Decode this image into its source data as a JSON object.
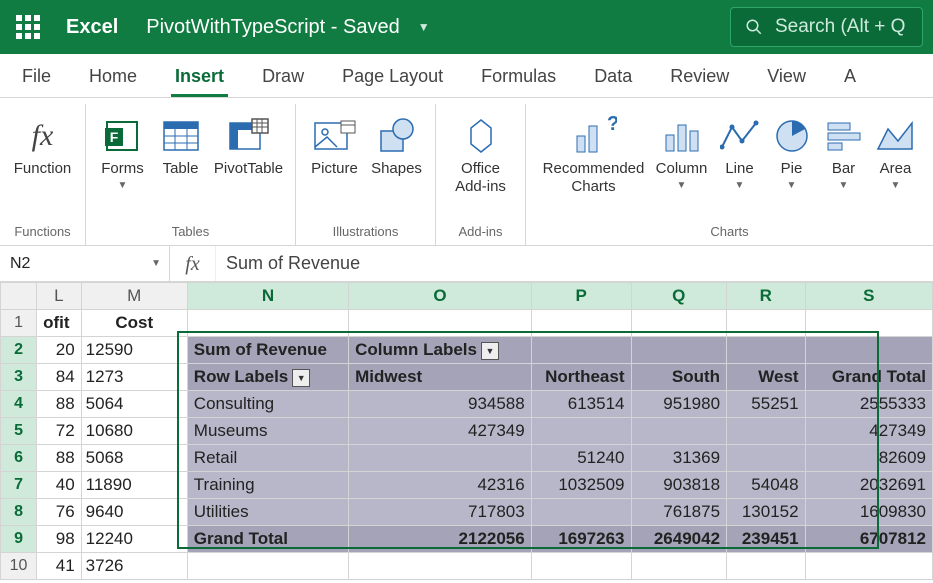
{
  "header": {
    "app": "Excel",
    "doc": "PivotWithTypeScript - Saved",
    "search_placeholder": "Search (Alt + Q"
  },
  "tabs": [
    "File",
    "Home",
    "Insert",
    "Draw",
    "Page Layout",
    "Formulas",
    "Data",
    "Review",
    "View",
    "A"
  ],
  "active_tab": "Insert",
  "ribbon": {
    "groups": [
      {
        "label": "Functions",
        "tools": [
          {
            "name": "Function"
          }
        ]
      },
      {
        "label": "Tables",
        "tools": [
          {
            "name": "Forms",
            "dd": true
          },
          {
            "name": "Table"
          },
          {
            "name": "PivotTable"
          }
        ]
      },
      {
        "label": "Illustrations",
        "tools": [
          {
            "name": "Picture"
          },
          {
            "name": "Shapes"
          }
        ]
      },
      {
        "label": "Add-ins",
        "tools": [
          {
            "name": "Office Add-ins"
          }
        ]
      },
      {
        "label": "Charts",
        "tools": [
          {
            "name": "Recommended Charts"
          },
          {
            "name": "Column",
            "dd": true
          },
          {
            "name": "Line",
            "dd": true
          },
          {
            "name": "Pie",
            "dd": true
          },
          {
            "name": "Bar",
            "dd": true
          },
          {
            "name": "Area",
            "dd": true
          }
        ]
      }
    ]
  },
  "namebox": "N2",
  "formula": "Sum of Revenue",
  "columns": [
    "",
    "L",
    "M",
    "N",
    "O",
    "P",
    "Q",
    "R",
    "S"
  ],
  "selected_cols": [
    "N",
    "O",
    "P",
    "Q",
    "R",
    "S"
  ],
  "left_data": {
    "header": {
      "L": "ofit",
      "M": "Cost"
    },
    "rows": [
      {
        "L": "20",
        "M": "12590"
      },
      {
        "L": "84",
        "M": "1273"
      },
      {
        "L": "88",
        "M": "5064"
      },
      {
        "L": "72",
        "M": "10680"
      },
      {
        "L": "88",
        "M": "5068"
      },
      {
        "L": "40",
        "M": "11890"
      },
      {
        "L": "76",
        "M": "9640"
      },
      {
        "L": "98",
        "M": "12240"
      },
      {
        "L": "41",
        "M": "3726"
      }
    ]
  },
  "pivot": {
    "title": "Sum of Revenue",
    "col_labels_title": "Column Labels",
    "row_labels_title": "Row Labels",
    "col_headers": [
      "Midwest",
      "Northeast",
      "South",
      "West",
      "Grand Total"
    ],
    "rows": [
      {
        "label": "Consulting",
        "vals": [
          "934588",
          "613514",
          "951980",
          "55251",
          "2555333"
        ]
      },
      {
        "label": "Museums",
        "vals": [
          "427349",
          "",
          "",
          "",
          "427349"
        ]
      },
      {
        "label": "Retail",
        "vals": [
          "",
          "51240",
          "31369",
          "",
          "82609"
        ]
      },
      {
        "label": "Training",
        "vals": [
          "42316",
          "1032509",
          "903818",
          "54048",
          "2032691"
        ]
      },
      {
        "label": "Utilities",
        "vals": [
          "717803",
          "",
          "761875",
          "130152",
          "1609830"
        ]
      }
    ],
    "grand_total": {
      "label": "Grand Total",
      "vals": [
        "2122056",
        "1697263",
        "2649042",
        "239451",
        "6707812"
      ]
    }
  },
  "chart_data": {
    "type": "table",
    "title": "Sum of Revenue",
    "columns": [
      "Midwest",
      "Northeast",
      "South",
      "West",
      "Grand Total"
    ],
    "rows": [
      "Consulting",
      "Museums",
      "Retail",
      "Training",
      "Utilities",
      "Grand Total"
    ],
    "values": [
      [
        934588,
        613514,
        951980,
        55251,
        2555333
      ],
      [
        427349,
        null,
        null,
        null,
        427349
      ],
      [
        null,
        51240,
        31369,
        null,
        82609
      ],
      [
        42316,
        1032509,
        903818,
        54048,
        2032691
      ],
      [
        717803,
        null,
        761875,
        130152,
        1609830
      ],
      [
        2122056,
        1697263,
        2649042,
        239451,
        6707812
      ]
    ]
  }
}
